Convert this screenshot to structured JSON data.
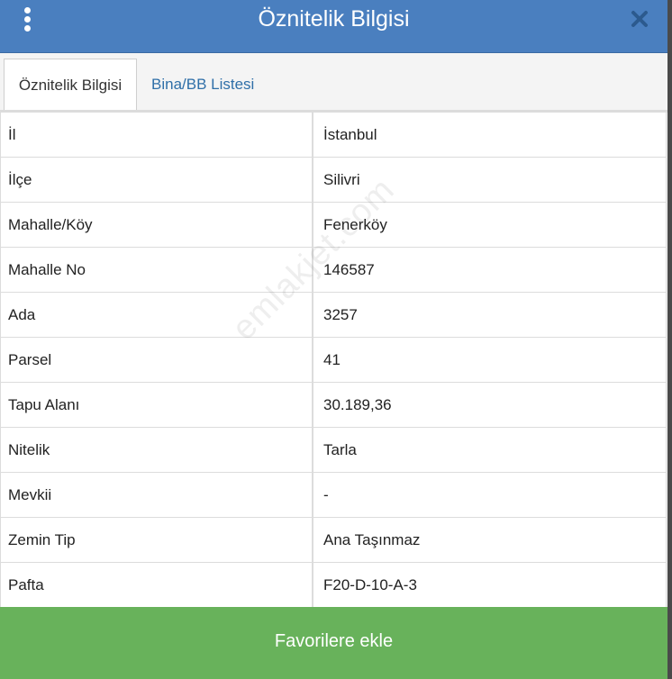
{
  "header": {
    "title": "Öznitelik Bilgisi",
    "menu_icon": "vertical-dots-icon",
    "close_icon": "close-icon",
    "background_color": "#4a7fbf"
  },
  "tabs": [
    {
      "label": "Öznitelik Bilgisi",
      "active": true
    },
    {
      "label": "Bina/BB Listesi",
      "active": false
    }
  ],
  "attributes": [
    {
      "label": "İl",
      "value": "İstanbul"
    },
    {
      "label": "İlçe",
      "value": "Silivri"
    },
    {
      "label": "Mahalle/Köy",
      "value": "Fenerköy"
    },
    {
      "label": "Mahalle No",
      "value": "146587"
    },
    {
      "label": "Ada",
      "value": "3257"
    },
    {
      "label": "Parsel",
      "value": "41"
    },
    {
      "label": "Tapu Alanı",
      "value": "30.189,36"
    },
    {
      "label": "Nitelik",
      "value": "Tarla"
    },
    {
      "label": "Mevkii",
      "value": "-"
    },
    {
      "label": "Zemin Tip",
      "value": "Ana Taşınmaz"
    },
    {
      "label": "Pafta",
      "value": "F20-D-10-A-3"
    }
  ],
  "watermark": "emlakjet.com",
  "favorite_button": {
    "label": "Favorilere ekle",
    "color": "#68b25b"
  }
}
